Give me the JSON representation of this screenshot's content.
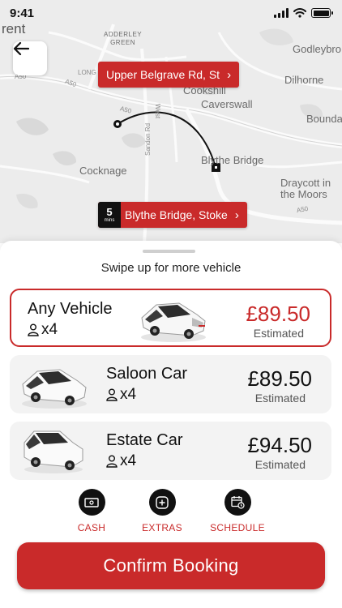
{
  "status_bar": {
    "time": "9:41"
  },
  "map": {
    "labels": {
      "rent": "rent",
      "adderley_green": "ADDERLEY\nGREEN",
      "godleybrook": "Godleybro",
      "dilhorne": "Dilhorne",
      "caverswall": "Caverswall",
      "cookshill": "Cookshill",
      "boundary": "Bounda",
      "blythe_bridge": "Blythe Bridge",
      "cocknage": "Cocknage",
      "sandon_rd": "Sandon Rd",
      "draycott": "Draycott in\nthe Moors",
      "a50_1": "A50",
      "a50_2": "A50",
      "a50_3": "A50",
      "a50_4": "A50",
      "long": "LONG",
      "west": "West"
    },
    "pickup": {
      "label": "Upper Belgrave Rd, St"
    },
    "dropoff": {
      "label": "Blythe Bridge, Stoke",
      "eta_value": "5",
      "eta_unit": "mins"
    }
  },
  "sheet": {
    "swipe_hint": "Swipe up for more vehicle",
    "vehicles": [
      {
        "name": "Any Vehicle",
        "seats": "x4",
        "price": "£89.50",
        "note": "Estimated",
        "selected": true
      },
      {
        "name": "Saloon Car",
        "seats": "x4",
        "price": "£89.50",
        "note": "Estimated",
        "selected": false
      },
      {
        "name": "Estate Car",
        "seats": "x4",
        "price": "£94.50",
        "note": "Estimated",
        "selected": false
      }
    ],
    "actions": [
      {
        "label": "CASH",
        "icon": "cash-icon"
      },
      {
        "label": "EXTRAS",
        "icon": "plus-icon"
      },
      {
        "label": "SCHEDULE",
        "icon": "calendar-clock-icon"
      }
    ],
    "confirm_label": "Confirm Booking"
  },
  "colors": {
    "accent": "#c92a2a",
    "map_bg": "#ececec",
    "card_bg": "#f3f3f3"
  }
}
